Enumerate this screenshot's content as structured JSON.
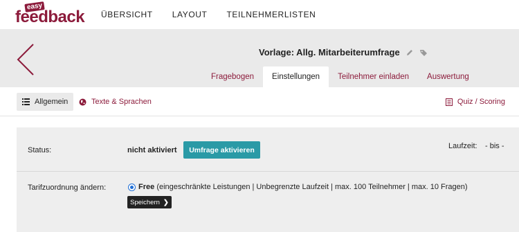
{
  "logo": {
    "small": "easy",
    "big": "feedback"
  },
  "topnav": {
    "items": [
      "ÜBERSICHT",
      "LAYOUT",
      "TEILNEHMERLISTEN"
    ]
  },
  "header": {
    "title": "Vorlage: Allg. Mitarbeiterumfrage",
    "tabs": [
      "Fragebogen",
      "Einstellungen",
      "Teilnehmer einladen",
      "Auswertung"
    ],
    "active_tab": "Einstellungen"
  },
  "subnav": {
    "general": "Allgemein",
    "texts": "Texte & Sprachen",
    "quiz": "Quiz / Scoring"
  },
  "settings": {
    "status_label": "Status:",
    "status_value": "nicht aktiviert",
    "activate_button": "Umfrage aktivieren",
    "runtime_label": "Laufzeit:",
    "runtime_value": "- bis -",
    "tarif_label": "Tarifzuordnung ändern:",
    "tarif_option_name": "Free",
    "tarif_option_desc": "(eingeschränkte Leistungen | Unbegrenzte Laufzeit | max. 100 Teilnehmer | max. 10 Fragen)",
    "save_button": "Speichern"
  },
  "colors": {
    "brand": "#8c1b3b",
    "accent": "#2a9aa6"
  },
  "icons": [
    "back-arrow-icon",
    "pencil-icon",
    "tag-icon",
    "list-icon",
    "globe-icon",
    "quiz-icon",
    "chevron-right-icon"
  ]
}
